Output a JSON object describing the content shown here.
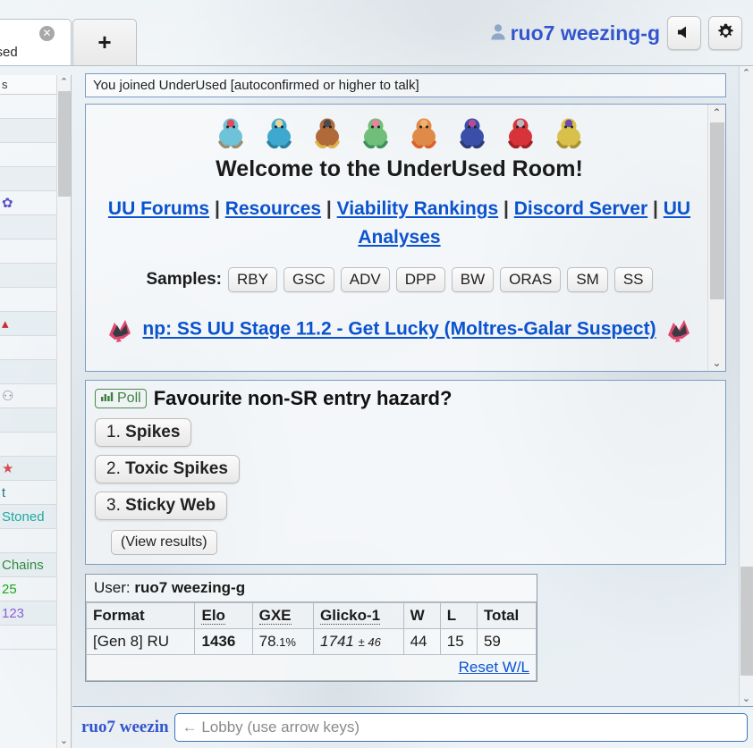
{
  "header": {
    "tab_room_label": "derUsed",
    "tab_room_full": "UnderUsed",
    "tab_close_glyph": "✕",
    "new_tab_glyph": "+",
    "username": "ruo7 weezing-g",
    "user_icon": "person-icon",
    "sound_icon": "speaker-icon",
    "settings_icon": "gear-icon"
  },
  "userlist": {
    "header_text": "s",
    "users": [
      {
        "name": "",
        "color": "#333333"
      },
      {
        "name": "",
        "color": "#333333"
      },
      {
        "name": "",
        "color": "#333333"
      },
      {
        "name": "",
        "color": "#333333"
      },
      {
        "name": "✿",
        "color": "#5b4fc7"
      },
      {
        "name": "",
        "color": "#333333"
      },
      {
        "name": "",
        "color": "#333333"
      },
      {
        "name": "",
        "color": "#333333"
      },
      {
        "name": "",
        "color": "#333333"
      },
      {
        "name": "▴",
        "color": "#c43030"
      },
      {
        "name": "",
        "color": "#333333"
      },
      {
        "name": "",
        "color": "#333333"
      },
      {
        "name": "⚇",
        "color": "#888888"
      },
      {
        "name": "",
        "color": "#333333"
      },
      {
        "name": "",
        "color": "#333333"
      },
      {
        "name": "★",
        "color": "#d94a54"
      },
      {
        "name": "t",
        "color": "#1f7a7a"
      },
      {
        "name": "Stoned",
        "color": "#1fa9a0"
      },
      {
        "name": "",
        "color": "#333333"
      },
      {
        "name": "Chains",
        "color": "#2e8b3d"
      },
      {
        "name": "25",
        "color": "#18a818"
      },
      {
        "name": "123",
        "color": "#8a5fd6"
      },
      {
        "name": "",
        "color": "#333333"
      }
    ],
    "scroll_up_glyph": "⌃",
    "scroll_down_glyph": "⌄"
  },
  "chat": {
    "join_notice": "You joined UnderUsed [autoconfirmed or higher to talk]",
    "scroll_up_glyph": "⌃",
    "scroll_down_glyph": "⌄"
  },
  "welcome_box": {
    "title": "Welcome to the UnderUsed Room!",
    "sprites": [
      {
        "name": "tentacruel-sprite",
        "body": "#6fc3d8",
        "accent": "#e04a5a",
        "limb": "#9a8e72"
      },
      {
        "name": "nidoqueen-sprite",
        "body": "#3fa8cf",
        "accent": "#e8d49a",
        "limb": "#2b7fa0"
      },
      {
        "name": "camerupt-sprite",
        "body": "#b06a3a",
        "accent": "#4a4a52",
        "limb": "#e0b24a"
      },
      {
        "name": "venusaur-sprite",
        "body": "#6fbf7a",
        "accent": "#ef7f9f",
        "limb": "#3f8f5a"
      },
      {
        "name": "victini-sprite",
        "body": "#e08a4a",
        "accent": "#f2b06a",
        "limb": "#d8622a"
      },
      {
        "name": "hydreigon-sprite",
        "body": "#3a4fa8",
        "accent": "#b84a9a",
        "limb": "#2a3a78"
      },
      {
        "name": "scizor-sprite",
        "body": "#d8333a",
        "accent": "#b8b8c0",
        "limb": "#a02028"
      },
      {
        "name": "aggron-sprite",
        "body": "#d8c04a",
        "accent": "#6a4aa8",
        "limb": "#a89230"
      }
    ],
    "links": [
      {
        "label": "UU Forums"
      },
      {
        "label": "Resources"
      },
      {
        "label": "Viability Rankings"
      },
      {
        "label": "Discord Server"
      },
      {
        "label": "UU Analyses"
      }
    ],
    "link_separator": "|",
    "samples_label": "Samples:",
    "samples": [
      "RBY",
      "GSC",
      "ADV",
      "DPP",
      "BW",
      "ORAS",
      "SM",
      "SS"
    ],
    "announcement": "np: SS UU Stage 11.2 - Get Lucky (Moltres-Galar Suspect)",
    "announcement_sprite": "moltres-galar-sprite"
  },
  "poll": {
    "badge_label": "Poll",
    "badge_icon": "bar-chart-icon",
    "question": "Favourite non-SR entry hazard?",
    "options": [
      {
        "num": "1.",
        "text": "Spikes"
      },
      {
        "num": "2.",
        "text": "Toxic Spikes"
      },
      {
        "num": "3.",
        "text": "Sticky Web"
      }
    ],
    "view_results_label": "(View results)"
  },
  "rank_table": {
    "user_label": "User:",
    "user_name": "ruo7 weezing-g",
    "columns": [
      "Format",
      "Elo",
      "GXE",
      "Glicko-1",
      "W",
      "L",
      "Total"
    ],
    "rows": [
      {
        "format": "[Gen 8] RU",
        "elo": "1436",
        "gxe_int": "78",
        "gxe_dec": ".1%",
        "glicko": "1741",
        "glicko_dev": "± 46",
        "w": "44",
        "l": "15",
        "total": "59"
      }
    ],
    "reset_label": "Reset W/L"
  },
  "chatbox": {
    "username": "ruo7 weezin",
    "input_value": "",
    "input_placeholder": "← Lobby (use arrow keys)"
  },
  "colors": {
    "link": "#0b53ce",
    "username": "#3355cc",
    "poll_green": "#3d803d",
    "panel_border": "#7b9cc4"
  }
}
